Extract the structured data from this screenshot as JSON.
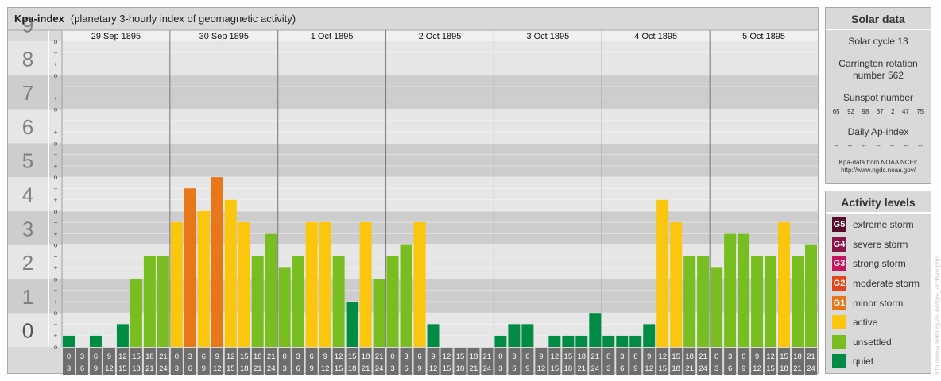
{
  "header": {
    "title": "Kpa-index",
    "subtitle": "(planetary 3-hourly index of geomagnetic activity)"
  },
  "chart_data": {
    "type": "bar",
    "title": "Kpa-index",
    "subtitle": "(planetary 3-hourly index of geomagnetic activity)",
    "ylim": [
      0,
      9
    ],
    "y_tick_labels": [
      "0",
      "1",
      "2",
      "3",
      "4",
      "5",
      "6",
      "7",
      "8",
      "9"
    ],
    "y_minor_labels": [
      "o",
      "+",
      "−"
    ],
    "days": [
      "29 Sep 1895",
      "30 Sep 1895",
      "1 Oct 1895",
      "2 Oct 1895",
      "3 Oct 1895",
      "4 Oct 1895",
      "5 Oct 1895"
    ],
    "interval_start_labels": [
      "0",
      "3",
      "6",
      "9",
      "12",
      "15",
      "18",
      "21"
    ],
    "interval_end_labels": [
      "3",
      "6",
      "9",
      "12",
      "15",
      "18",
      "21",
      "24"
    ],
    "values": [
      [
        0.33,
        0,
        0.33,
        0,
        0.67,
        2,
        2.67,
        2.67
      ],
      [
        3.67,
        4.67,
        4,
        5,
        4.33,
        3.67,
        2.67,
        3.33
      ],
      [
        2.33,
        2.67,
        3.67,
        3.67,
        2.67,
        1.33,
        3.67,
        2
      ],
      [
        2.67,
        3,
        3.67,
        0.67,
        0,
        0,
        0,
        0
      ],
      [
        0.33,
        0.67,
        0.67,
        0,
        0.33,
        0.33,
        0.33,
        1
      ],
      [
        0.33,
        0.33,
        0.33,
        0.67,
        4.33,
        3.67,
        2.67,
        2.67
      ],
      [
        2.33,
        3.33,
        3.33,
        2.67,
        2.67,
        3.67,
        2.67,
        3
      ]
    ],
    "grid": true
  },
  "solar": {
    "header": "Solar data",
    "cycle": "Solar cycle 13",
    "carrington_line1": "Carrington rotation",
    "carrington_line2": "number 562",
    "sunspot_label": "Sunspot number",
    "sunspot_values": [
      "65",
      "92",
      "98",
      "37",
      "2",
      "47",
      "75"
    ],
    "ap_label": "Daily Ap-index",
    "ap_values": [
      "--",
      "--",
      "--",
      "--",
      "--",
      "--",
      "--"
    ],
    "source_line1": "Kpa-data from NOAA NCEI:",
    "source_line2": "http://www.ngdc.noaa.gov/"
  },
  "activity": {
    "header": "Activity levels",
    "levels": [
      {
        "badge": "G5",
        "label": "extreme storm",
        "color": "#5a0a2a"
      },
      {
        "badge": "G4",
        "label": "severe storm",
        "color": "#8b1548"
      },
      {
        "badge": "G3",
        "label": "strong storm",
        "color": "#c5155f"
      },
      {
        "badge": "G2",
        "label": "moderate storm",
        "color": "#e3461b"
      },
      {
        "badge": "G1",
        "label": "minor storm",
        "color": "#e8771a"
      },
      {
        "badge": "",
        "label": "active",
        "color": "#fac60e"
      },
      {
        "badge": "",
        "label": "unsettled",
        "color": "#78be21"
      },
      {
        "badge": "",
        "label": "quiet",
        "color": "#008c45"
      }
    ]
  },
  "watermark": "http://www.freiburg-au.de/kpa_archive.php"
}
